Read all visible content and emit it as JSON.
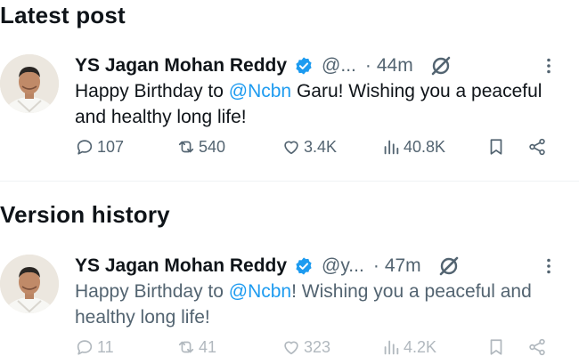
{
  "sections": {
    "latest_title": "Latest post",
    "history_title": "Version history"
  },
  "posts": [
    {
      "author_name": "YS Jagan Mohan Reddy",
      "handle": "@...",
      "time_separator": "·",
      "time": "44m",
      "text_before": "Happy Birthday to ",
      "mention": "@Ncbn",
      "text_after": " Garu! Wishing you a peaceful and healthy long life!",
      "stats": {
        "replies": "107",
        "reposts": "540",
        "likes": "3.4K",
        "views": "40.8K"
      }
    },
    {
      "author_name": "YS Jagan Mohan Reddy",
      "handle": "@y...",
      "time_separator": "·",
      "time": "47m",
      "text_before": "Happy Birthday to ",
      "mention": "@Ncbn",
      "text_after": "! Wishing you a peaceful and healthy long life!",
      "stats": {
        "replies": "11",
        "reposts": "41",
        "likes": "323",
        "views": "4.2K"
      }
    }
  ],
  "icons": {
    "verified": "verified-badge-icon",
    "grok": "grok-icon",
    "more": "more-options-icon",
    "reply": "reply-icon",
    "repost": "repost-icon",
    "like": "like-heart-icon",
    "views": "views-chart-icon",
    "bookmark": "bookmark-icon",
    "share": "share-icon"
  },
  "colors": {
    "text": "#0f1419",
    "secondary": "#536471",
    "accent": "#1d9bf0",
    "divider": "#eff3f4"
  }
}
